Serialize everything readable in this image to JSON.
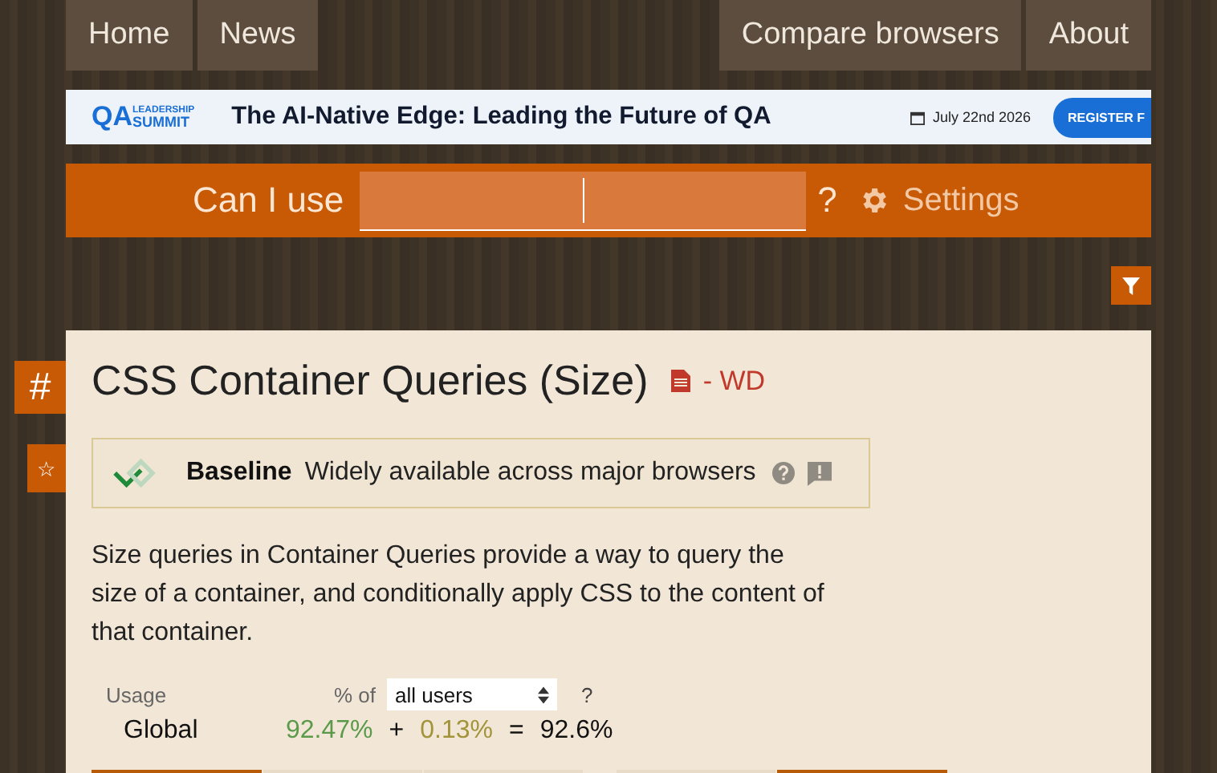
{
  "nav": {
    "left": [
      {
        "label": "Home"
      },
      {
        "label": "News"
      }
    ],
    "right": [
      {
        "label": "Compare browsers"
      },
      {
        "label": "About"
      }
    ]
  },
  "banner": {
    "logo_top": "LEADERSHIP",
    "logo_mark": "QA",
    "logo_bottom": "SUMMIT",
    "headline": "The AI-Native Edge: Leading the Future of QA",
    "date": "July 22nd 2026",
    "button": "REGISTER F"
  },
  "search": {
    "label": "Can I use",
    "suffix": "?",
    "settings": "Settings"
  },
  "feature": {
    "anchor": "#",
    "star": "☆",
    "title": "CSS Container Queries (Size)",
    "status": "- WD",
    "baseline": {
      "label": "Baseline",
      "text": "Widely available across major browsers"
    },
    "description": "Size queries in Container Queries provide a way to query the size of a container, and conditionally apply CSS to the content of that container.",
    "usage": {
      "label": "Usage",
      "percent_of": "% of",
      "audience": "all users",
      "help": "?",
      "region": "Global",
      "full": "92.47%",
      "plus": "+",
      "partial": "0.13%",
      "equals": "=",
      "total": "92.6%"
    }
  },
  "browser_columns": [
    {
      "kind": "current"
    },
    {
      "kind": "plain"
    },
    {
      "kind": "plain"
    },
    {
      "kind": "gap"
    },
    {
      "kind": "plain"
    },
    {
      "kind": "current"
    }
  ]
}
